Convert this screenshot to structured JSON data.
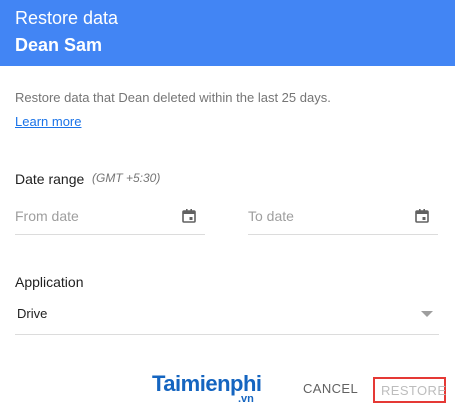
{
  "header": {
    "title": "Restore data",
    "subtitle": "Dean Sam",
    "color": "#4285f4"
  },
  "description": "Restore data that Dean deleted within the last 25 days.",
  "learn_more": "Learn more",
  "date_range": {
    "label": "Date range",
    "timezone": "(GMT +5:30)",
    "from_placeholder": "From date",
    "to_placeholder": "To date",
    "icon": "calendar-icon"
  },
  "application": {
    "label": "Application",
    "selected": "Drive"
  },
  "watermark": {
    "brand": "Taimienphi",
    "tld": ".vn"
  },
  "actions": {
    "cancel": "CANCEL",
    "restore": "RESTORE",
    "restore_highlight_color": "#e53935"
  }
}
